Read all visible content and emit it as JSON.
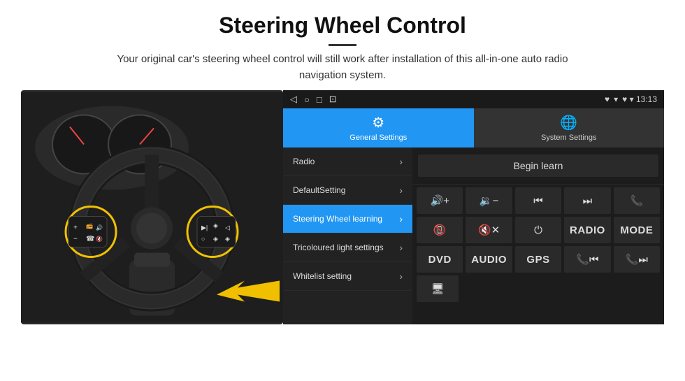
{
  "page": {
    "title": "Steering Wheel Control",
    "divider": true,
    "description": "Your original car's steering wheel control will still work after installation of this all-in-one auto radio navigation system."
  },
  "status_bar": {
    "icons": [
      "◁",
      "○",
      "□",
      "⊡"
    ],
    "right_info": "♥ ▾ 13:13"
  },
  "tabs": [
    {
      "id": "general",
      "icon": "⚙",
      "label": "General Settings",
      "active": true
    },
    {
      "id": "system",
      "icon": "🌐",
      "label": "System Settings",
      "active": false
    }
  ],
  "menu_items": [
    {
      "id": "radio",
      "label": "Radio",
      "active": false
    },
    {
      "id": "default",
      "label": "DefaultSetting",
      "active": false
    },
    {
      "id": "steering",
      "label": "Steering Wheel learning",
      "active": true
    },
    {
      "id": "tricoloured",
      "label": "Tricoloured light settings",
      "active": false
    },
    {
      "id": "whitelist",
      "label": "Whitelist setting",
      "active": false
    }
  ],
  "right_panel": {
    "begin_learn_label": "Begin learn",
    "button_rows": [
      [
        {
          "id": "vol_up",
          "icon": "🔊+",
          "type": "icon"
        },
        {
          "id": "vol_down",
          "icon": "🔉-",
          "type": "icon"
        },
        {
          "id": "prev_track",
          "icon": "⏮",
          "type": "icon"
        },
        {
          "id": "next_track",
          "icon": "⏭",
          "type": "icon"
        },
        {
          "id": "phone",
          "icon": "📞",
          "type": "icon"
        }
      ],
      [
        {
          "id": "call_end",
          "icon": "📵",
          "type": "icon"
        },
        {
          "id": "mute",
          "icon": "🔇×",
          "type": "icon"
        },
        {
          "id": "power",
          "icon": "⏻",
          "type": "icon"
        },
        {
          "id": "radio_btn",
          "label": "RADIO",
          "type": "text"
        },
        {
          "id": "mode_btn",
          "label": "MODE",
          "type": "text"
        }
      ],
      [
        {
          "id": "dvd_btn",
          "label": "DVD",
          "type": "text"
        },
        {
          "id": "audio_btn",
          "label": "AUDIO",
          "type": "text"
        },
        {
          "id": "gps_btn",
          "label": "GPS",
          "type": "text"
        },
        {
          "id": "tel_prev",
          "icon": "📞⏮",
          "type": "icon"
        },
        {
          "id": "tel_next",
          "icon": "📞⏭",
          "type": "icon"
        }
      ],
      [
        {
          "id": "extra",
          "icon": "🖥",
          "type": "icon"
        }
      ]
    ]
  },
  "colors": {
    "active_blue": "#2196F3",
    "dark_bg": "#1a1a1a",
    "panel_bg": "#222",
    "btn_bg": "#2a2a2a"
  }
}
